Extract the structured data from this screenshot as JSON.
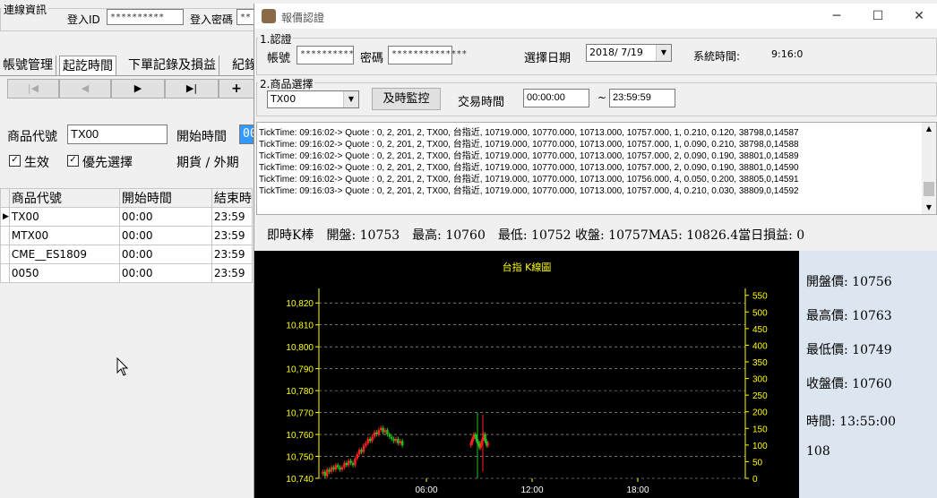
{
  "bg": {
    "conn_group_title": "連線資訊",
    "login_id_label": "登入ID",
    "login_id_value": "**********",
    "login_pw_label": "登入密碼",
    "login_pw_value": "**",
    "tabs": [
      "帳號管理",
      "起訖時間",
      "下單記錄及損益",
      "紀錄"
    ],
    "nav": [
      "|◀",
      "◀",
      "▶",
      "▶|",
      "+"
    ],
    "product_code_label": "商品代號",
    "product_code_value": "TX00",
    "start_time_label": "開始時間",
    "start_time_value": "00",
    "effective_label": "生效",
    "priority_label": "優先選擇",
    "futures_label": "期貨 / 外期",
    "grid_headers": [
      "商品代號",
      "開始時間",
      "結束時"
    ],
    "grid_rows": [
      {
        "code": "TX00",
        "start": "00:00",
        "end": "23:59"
      },
      {
        "code": "MTX00",
        "start": "00:00",
        "end": "23:59"
      },
      {
        "code": "CME__ES1809",
        "start": "00:00",
        "end": "23:59"
      },
      {
        "code": "0050",
        "start": "00:00",
        "end": "23:59"
      }
    ]
  },
  "win": {
    "title": "報價認證",
    "section1": "1.認證",
    "account_label": "帳號",
    "account_value": "**********",
    "password_label": "密碼",
    "password_value": "**************",
    "date_label": "選擇日期",
    "date_value": "2018/ 7/19",
    "sys_time_label": "系統時間:",
    "sys_time_value": "9:16:0",
    "section2": "2.商品選擇",
    "product_value": "TX00",
    "monitor_button": "及時監控",
    "trade_time_label": "交易時間",
    "trade_time_from": "00:00:00",
    "trade_time_sep": "~",
    "trade_time_to": "23:59:59",
    "log_lines": [
      "TickTime: 09:16:02-> Quote : 0, 2, 201, 2, TX00, 台指近, 10719.000, 10770.000, 10713.000, 10757.000, 1, 0.210, 0.120, 38798,0,14587",
      "TickTime: 09:16:02-> Quote : 0, 2, 201, 2, TX00, 台指近, 10719.000, 10770.000, 10713.000, 10757.000, 1, 0.090, 0.210, 38798,0,14588",
      "TickTime: 09:16:02-> Quote : 0, 2, 201, 2, TX00, 台指近, 10719.000, 10770.000, 10713.000, 10757.000, 2, 0.090, 0.190, 38801,0,14589",
      "TickTime: 09:16:02-> Quote : 0, 2, 201, 2, TX00, 台指近, 10719.000, 10770.000, 10713.000, 10757.000, 2, 0.090, 0.190, 38801,0,14590",
      "TickTime: 09:16:02-> Quote : 0, 2, 201, 2, TX00, 台指近, 10719.000, 10770.000, 10713.000, 10756.000, 4, 0.050, 0.200, 38805,0,14591",
      "TickTime: 09:16:03-> Quote : 0, 2, 201, 2, TX00, 台指近, 10719.000, 10770.000, 10713.000, 10757.000, 4, 0.210, 0.030, 38809,0,14592"
    ],
    "status_line": "即時K棒　開盤: 10753　最高: 10760　最低: 10752 收盤: 10757MA5: 10826.4當日損益: 0",
    "side": {
      "open": "開盤價: 10756",
      "high": "最高價: 10763",
      "low": "最低價: 10749",
      "close": "收盤價: 10760",
      "time": "時間: 13:55:00",
      "count": "108"
    }
  },
  "chart_data": {
    "type": "candlestick",
    "title": "台指 K線圖",
    "left_axis": {
      "ticks": [
        "10,740",
        "10,750",
        "10,760",
        "10,770",
        "10,780",
        "10,790",
        "10,800",
        "10,810",
        "10,820"
      ],
      "ylim": [
        10740,
        10825
      ]
    },
    "right_axis": {
      "ticks": [
        "0",
        "50",
        "100",
        "150",
        "200",
        "250",
        "300",
        "350",
        "400",
        "450",
        "500",
        "550"
      ],
      "ylim": [
        0,
        560
      ]
    },
    "x_ticks": [
      "06:00",
      "12:00",
      "18:00"
    ],
    "colors": {
      "up": "#ff2020",
      "down": "#20c020",
      "title": "#ffff00",
      "axis": "#ffff00"
    },
    "cluster1_prices": [
      10742,
      10743,
      10741,
      10744,
      10743,
      10745,
      10744,
      10746,
      10745,
      10744,
      10745,
      10747,
      10746,
      10748,
      10747,
      10746,
      10749,
      10751,
      10753,
      10752,
      10755,
      10756,
      10758,
      10757,
      10759,
      10761,
      10760,
      10762,
      10763,
      10761,
      10762,
      10760,
      10759,
      10758,
      10757,
      10758,
      10756,
      10757,
      10755
    ],
    "cluster2_prices": [
      10755,
      10756,
      10758,
      10760,
      10759,
      10757,
      10756,
      10754,
      10756,
      10758,
      10760,
      10757,
      10755,
      10756
    ]
  }
}
